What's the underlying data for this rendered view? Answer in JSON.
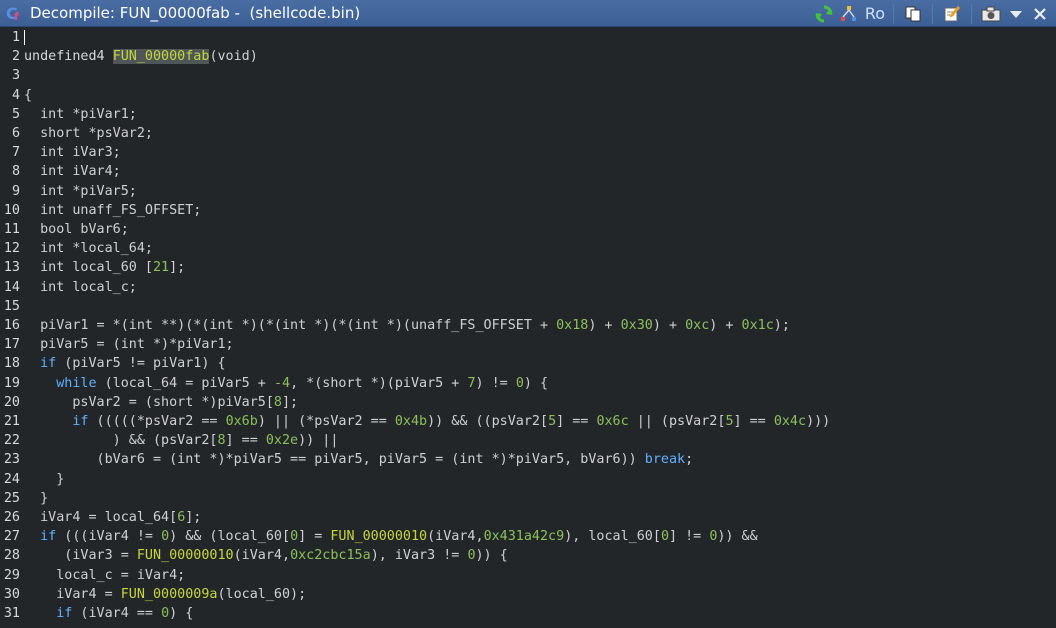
{
  "window": {
    "title": "Decompile: FUN_00000fab -  (shellcode.bin)",
    "icons": [
      "ghidra-decompiler-icon",
      "refresh-icon",
      "graph-icon",
      "ro-icon",
      "copy-icon",
      "edit-icon",
      "snapshot-icon",
      "dropdown-icon",
      "close-icon"
    ],
    "ro_label": "Ro"
  },
  "colors": {
    "background": "#232629",
    "default": "#d0d0d0",
    "number": "#8ac05a",
    "keyword": "#5fb0ff",
    "function": "#c6d63a",
    "type": "#d8d8d8",
    "highlight": "#4e5657",
    "titlebar": "#3c5f96"
  },
  "code": {
    "lines": [
      {
        "n": "1",
        "tokens": []
      },
      {
        "n": "2",
        "tokens": [
          {
            "t": "undefined4 ",
            "c": "type"
          },
          {
            "t": "FUN_00000fab",
            "c": "fnhl"
          },
          {
            "t": "(void)",
            "c": "default"
          }
        ]
      },
      {
        "n": "3",
        "tokens": []
      },
      {
        "n": "4",
        "tokens": [
          {
            "t": "{",
            "c": "default"
          }
        ]
      },
      {
        "n": "5",
        "tokens": [
          {
            "t": "  int *piVar1;",
            "c": "default"
          }
        ]
      },
      {
        "n": "6",
        "tokens": [
          {
            "t": "  short *psVar2;",
            "c": "default"
          }
        ]
      },
      {
        "n": "7",
        "tokens": [
          {
            "t": "  int iVar3;",
            "c": "default"
          }
        ]
      },
      {
        "n": "8",
        "tokens": [
          {
            "t": "  int iVar4;",
            "c": "default"
          }
        ]
      },
      {
        "n": "9",
        "tokens": [
          {
            "t": "  int *piVar5;",
            "c": "default"
          }
        ]
      },
      {
        "n": "10",
        "tokens": [
          {
            "t": "  int unaff_FS_OFFSET;",
            "c": "default"
          }
        ]
      },
      {
        "n": "11",
        "tokens": [
          {
            "t": "  bool bVar6;",
            "c": "default"
          }
        ]
      },
      {
        "n": "12",
        "tokens": [
          {
            "t": "  int *local_64;",
            "c": "default"
          }
        ]
      },
      {
        "n": "13",
        "tokens": [
          {
            "t": "  int local_60 [",
            "c": "default"
          },
          {
            "t": "21",
            "c": "number"
          },
          {
            "t": "];",
            "c": "default"
          }
        ]
      },
      {
        "n": "14",
        "tokens": [
          {
            "t": "  int local_c;",
            "c": "default"
          }
        ]
      },
      {
        "n": "15",
        "tokens": []
      },
      {
        "n": "16",
        "tokens": [
          {
            "t": "  piVar1 = *(int **)(*(int *)(*(int *)(*(int *)(unaff_FS_OFFSET + ",
            "c": "default"
          },
          {
            "t": "0x18",
            "c": "number"
          },
          {
            "t": ") + ",
            "c": "default"
          },
          {
            "t": "0x30",
            "c": "number"
          },
          {
            "t": ") + ",
            "c": "default"
          },
          {
            "t": "0xc",
            "c": "number"
          },
          {
            "t": ") + ",
            "c": "default"
          },
          {
            "t": "0x1c",
            "c": "number"
          },
          {
            "t": ");",
            "c": "default"
          }
        ]
      },
      {
        "n": "17",
        "tokens": [
          {
            "t": "  piVar5 = (int *)*piVar1;",
            "c": "default"
          }
        ]
      },
      {
        "n": "18",
        "tokens": [
          {
            "t": "  ",
            "c": "default"
          },
          {
            "t": "if",
            "c": "keyword"
          },
          {
            "t": " (piVar5 != piVar1) {",
            "c": "default"
          }
        ]
      },
      {
        "n": "19",
        "tokens": [
          {
            "t": "    ",
            "c": "default"
          },
          {
            "t": "while",
            "c": "keyword"
          },
          {
            "t": " (local_64 = piVar5 + ",
            "c": "default"
          },
          {
            "t": "-4",
            "c": "number"
          },
          {
            "t": ", *(short *)(piVar5 + ",
            "c": "default"
          },
          {
            "t": "7",
            "c": "number"
          },
          {
            "t": ") != ",
            "c": "default"
          },
          {
            "t": "0",
            "c": "number"
          },
          {
            "t": ") {",
            "c": "default"
          }
        ]
      },
      {
        "n": "20",
        "tokens": [
          {
            "t": "      psVar2 = (short *)piVar5[",
            "c": "default"
          },
          {
            "t": "8",
            "c": "number"
          },
          {
            "t": "];",
            "c": "default"
          }
        ]
      },
      {
        "n": "21",
        "tokens": [
          {
            "t": "      ",
            "c": "default"
          },
          {
            "t": "if",
            "c": "keyword"
          },
          {
            "t": " (((((*psVar2 == ",
            "c": "default"
          },
          {
            "t": "0x6b",
            "c": "number"
          },
          {
            "t": ") || (*psVar2 == ",
            "c": "default"
          },
          {
            "t": "0x4b",
            "c": "number"
          },
          {
            "t": ")) && ((psVar2[",
            "c": "default"
          },
          {
            "t": "5",
            "c": "number"
          },
          {
            "t": "] == ",
            "c": "default"
          },
          {
            "t": "0x6c",
            "c": "number"
          },
          {
            "t": " || (psVar2[",
            "c": "default"
          },
          {
            "t": "5",
            "c": "number"
          },
          {
            "t": "] == ",
            "c": "default"
          },
          {
            "t": "0x4c",
            "c": "number"
          },
          {
            "t": ")))",
            "c": "default"
          }
        ]
      },
      {
        "n": "22",
        "tokens": [
          {
            "t": "           ) && (psVar2[",
            "c": "default"
          },
          {
            "t": "8",
            "c": "number"
          },
          {
            "t": "] == ",
            "c": "default"
          },
          {
            "t": "0x2e",
            "c": "number"
          },
          {
            "t": ")) ||",
            "c": "default"
          }
        ]
      },
      {
        "n": "23",
        "tokens": [
          {
            "t": "         (bVar6 = (int *)*piVar5 == piVar5, piVar5 = (int *)*piVar5, bVar6)) ",
            "c": "default"
          },
          {
            "t": "break",
            "c": "keyword"
          },
          {
            "t": ";",
            "c": "default"
          }
        ]
      },
      {
        "n": "24",
        "tokens": [
          {
            "t": "    }",
            "c": "default"
          }
        ]
      },
      {
        "n": "25",
        "tokens": [
          {
            "t": "  }",
            "c": "default"
          }
        ]
      },
      {
        "n": "26",
        "tokens": [
          {
            "t": "  iVar4 = local_64[",
            "c": "default"
          },
          {
            "t": "6",
            "c": "number"
          },
          {
            "t": "];",
            "c": "default"
          }
        ]
      },
      {
        "n": "27",
        "tokens": [
          {
            "t": "  ",
            "c": "default"
          },
          {
            "t": "if",
            "c": "keyword"
          },
          {
            "t": " (((iVar4 != ",
            "c": "default"
          },
          {
            "t": "0",
            "c": "number"
          },
          {
            "t": ") && (local_60[",
            "c": "default"
          },
          {
            "t": "0",
            "c": "number"
          },
          {
            "t": "] = ",
            "c": "default"
          },
          {
            "t": "FUN_00000010",
            "c": "function"
          },
          {
            "t": "(iVar4,",
            "c": "default"
          },
          {
            "t": "0x431a42c9",
            "c": "number"
          },
          {
            "t": "), local_60[",
            "c": "default"
          },
          {
            "t": "0",
            "c": "number"
          },
          {
            "t": "] != ",
            "c": "default"
          },
          {
            "t": "0",
            "c": "number"
          },
          {
            "t": ")) &&",
            "c": "default"
          }
        ]
      },
      {
        "n": "28",
        "tokens": [
          {
            "t": "     (iVar3 = ",
            "c": "default"
          },
          {
            "t": "FUN_00000010",
            "c": "function"
          },
          {
            "t": "(iVar4,",
            "c": "default"
          },
          {
            "t": "0xc2cbc15a",
            "c": "number"
          },
          {
            "t": "), iVar3 != ",
            "c": "default"
          },
          {
            "t": "0",
            "c": "number"
          },
          {
            "t": ")) {",
            "c": "default"
          }
        ]
      },
      {
        "n": "29",
        "tokens": [
          {
            "t": "    local_c = iVar4;",
            "c": "default"
          }
        ]
      },
      {
        "n": "30",
        "tokens": [
          {
            "t": "    iVar4 = ",
            "c": "default"
          },
          {
            "t": "FUN_0000009a",
            "c": "function"
          },
          {
            "t": "(local_60);",
            "c": "default"
          }
        ]
      },
      {
        "n": "31",
        "tokens": [
          {
            "t": "    ",
            "c": "default"
          },
          {
            "t": "if",
            "c": "keyword"
          },
          {
            "t": " (iVar4 == ",
            "c": "default"
          },
          {
            "t": "0",
            "c": "number"
          },
          {
            "t": ") {",
            "c": "default"
          }
        ]
      }
    ]
  }
}
